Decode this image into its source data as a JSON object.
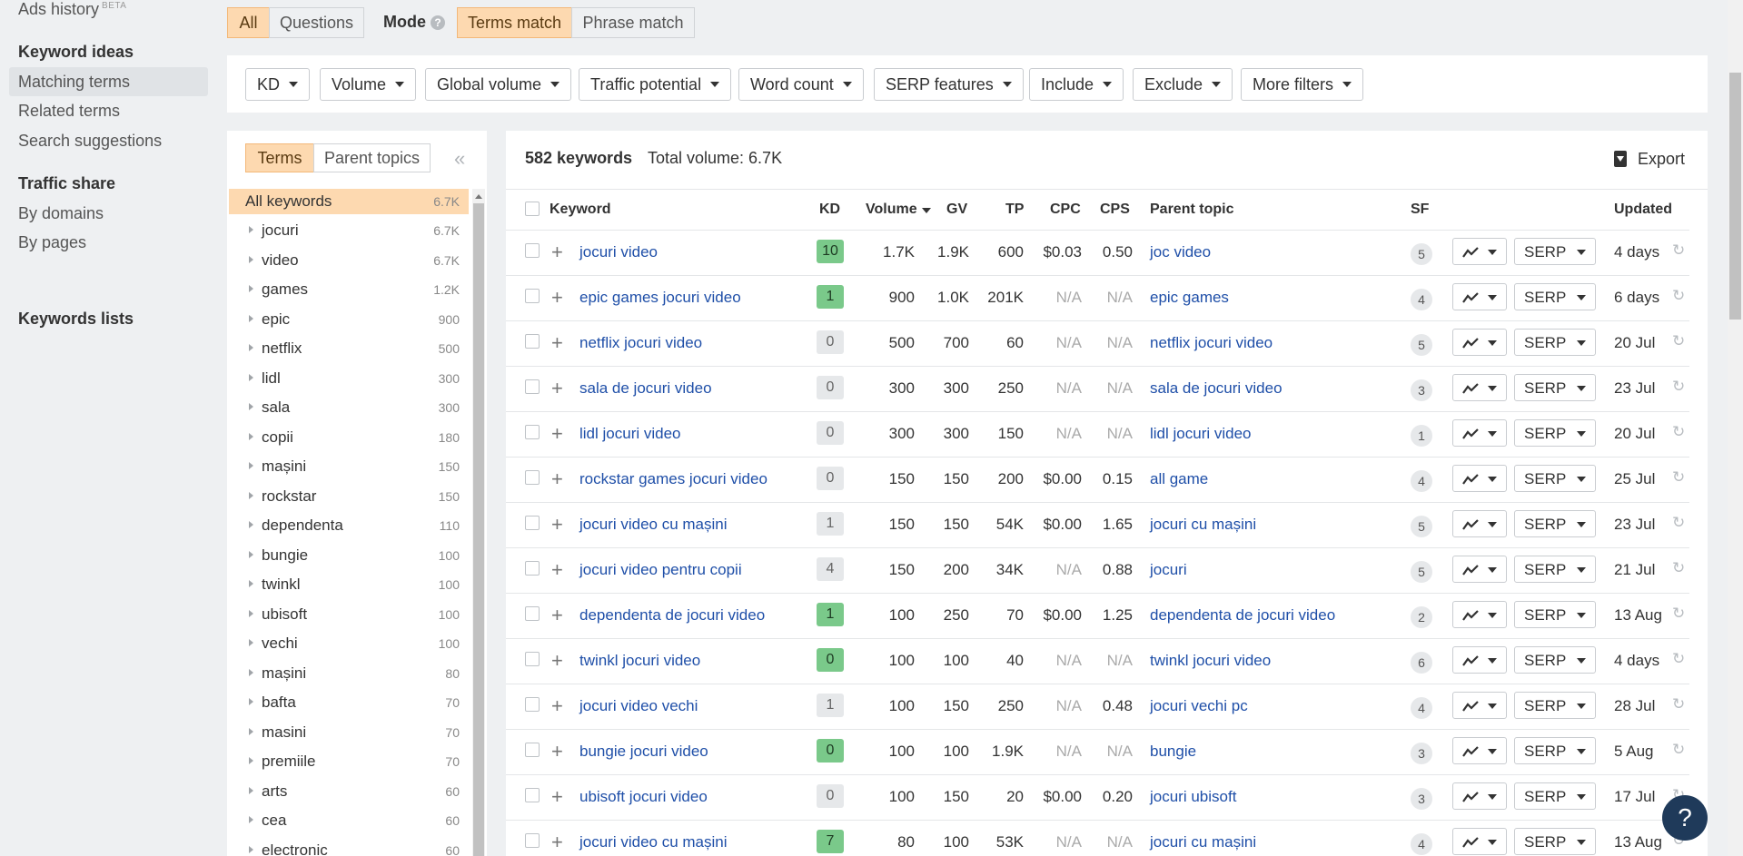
{
  "sidebar": {
    "ads_history": "Ads history",
    "beta": "BETA",
    "keyword_ideas_heading": "Keyword ideas",
    "keyword_ideas": [
      "Matching terms",
      "Related terms",
      "Search suggestions"
    ],
    "traffic_share_heading": "Traffic share",
    "traffic_share": [
      "By domains",
      "By pages"
    ],
    "keywords_lists_heading": "Keywords lists"
  },
  "mode_bar": {
    "all": "All",
    "questions": "Questions",
    "mode_label": "Mode",
    "help": "?",
    "terms_match": "Terms match",
    "phrase_match": "Phrase match"
  },
  "filters": [
    "KD",
    "Volume",
    "Global volume",
    "Traffic potential",
    "Word count",
    "SERP features",
    "Include",
    "Exclude",
    "More filters"
  ],
  "left_panel": {
    "tab_terms": "Terms",
    "tab_parent_topics": "Parent topics",
    "collapse": "«",
    "all_keywords": {
      "name": "All keywords",
      "count": "6.7K"
    },
    "items": [
      {
        "name": "jocuri",
        "count": "6.7K"
      },
      {
        "name": "video",
        "count": "6.7K"
      },
      {
        "name": "games",
        "count": "1.2K"
      },
      {
        "name": "epic",
        "count": "900"
      },
      {
        "name": "netflix",
        "count": "500"
      },
      {
        "name": "lidl",
        "count": "300"
      },
      {
        "name": "sala",
        "count": "300"
      },
      {
        "name": "copii",
        "count": "180"
      },
      {
        "name": "mașini",
        "count": "150"
      },
      {
        "name": "rockstar",
        "count": "150"
      },
      {
        "name": "dependenta",
        "count": "110"
      },
      {
        "name": "bungie",
        "count": "100"
      },
      {
        "name": "twinkl",
        "count": "100"
      },
      {
        "name": "ubisoft",
        "count": "100"
      },
      {
        "name": "vechi",
        "count": "100"
      },
      {
        "name": "mașini",
        "count": "80"
      },
      {
        "name": "bafta",
        "count": "70"
      },
      {
        "name": "masini",
        "count": "70"
      },
      {
        "name": "premiile",
        "count": "70"
      },
      {
        "name": "arts",
        "count": "60"
      },
      {
        "name": "cea",
        "count": "60"
      },
      {
        "name": "electronic",
        "count": "60"
      }
    ]
  },
  "table": {
    "keyword_count": "582 keywords",
    "total_volume": "Total volume: 6.7K",
    "export": "Export",
    "headers": {
      "keyword": "Keyword",
      "kd": "KD",
      "volume": "Volume",
      "gv": "GV",
      "tp": "TP",
      "cpc": "CPC",
      "cps": "CPS",
      "parent_topic": "Parent topic",
      "sf": "SF",
      "updated": "Updated"
    },
    "serp_label": "SERP",
    "rows": [
      {
        "keyword": "jocuri video",
        "kd": "10",
        "kd_level": "green",
        "volume": "1.7K",
        "gv": "1.9K",
        "tp": "600",
        "cpc": "$0.03",
        "cps": "0.50",
        "parent": "joc video",
        "sf": "5",
        "updated": "4 days"
      },
      {
        "keyword": "epic games jocuri video",
        "kd": "1",
        "kd_level": "green",
        "volume": "900",
        "gv": "1.0K",
        "tp": "201K",
        "cpc": "N/A",
        "cps": "N/A",
        "parent": "epic games",
        "sf": "4",
        "updated": "6 days"
      },
      {
        "keyword": "netflix jocuri video",
        "kd": "0",
        "kd_level": "grey",
        "volume": "500",
        "gv": "700",
        "tp": "60",
        "cpc": "N/A",
        "cps": "N/A",
        "parent": "netflix jocuri video",
        "sf": "5",
        "updated": "20 Jul"
      },
      {
        "keyword": "sala de jocuri video",
        "kd": "0",
        "kd_level": "grey",
        "volume": "300",
        "gv": "300",
        "tp": "250",
        "cpc": "N/A",
        "cps": "N/A",
        "parent": "sala de jocuri video",
        "sf": "3",
        "updated": "23 Jul"
      },
      {
        "keyword": "lidl jocuri video",
        "kd": "0",
        "kd_level": "grey",
        "volume": "300",
        "gv": "300",
        "tp": "150",
        "cpc": "N/A",
        "cps": "N/A",
        "parent": "lidl jocuri video",
        "sf": "1",
        "updated": "20 Jul"
      },
      {
        "keyword": "rockstar games jocuri video",
        "kd": "0",
        "kd_level": "grey",
        "volume": "150",
        "gv": "150",
        "tp": "200",
        "cpc": "$0.00",
        "cps": "0.15",
        "parent": "all game",
        "sf": "4",
        "updated": "25 Jul"
      },
      {
        "keyword": "jocuri video cu mașini",
        "kd": "1",
        "kd_level": "grey",
        "volume": "150",
        "gv": "150",
        "tp": "54K",
        "cpc": "$0.00",
        "cps": "1.65",
        "parent": "jocuri cu mașini",
        "sf": "5",
        "updated": "23 Jul"
      },
      {
        "keyword": "jocuri video pentru copii",
        "kd": "4",
        "kd_level": "grey",
        "volume": "150",
        "gv": "200",
        "tp": "34K",
        "cpc": "N/A",
        "cps": "0.88",
        "parent": "jocuri",
        "sf": "5",
        "updated": "21 Jul"
      },
      {
        "keyword": "dependenta de jocuri video",
        "kd": "1",
        "kd_level": "green",
        "volume": "100",
        "gv": "250",
        "tp": "70",
        "cpc": "$0.00",
        "cps": "1.25",
        "parent": "dependenta de jocuri video",
        "sf": "2",
        "updated": "13 Aug"
      },
      {
        "keyword": "twinkl jocuri video",
        "kd": "0",
        "kd_level": "green",
        "volume": "100",
        "gv": "100",
        "tp": "40",
        "cpc": "N/A",
        "cps": "N/A",
        "parent": "twinkl jocuri video",
        "sf": "6",
        "updated": "4 days"
      },
      {
        "keyword": "jocuri video vechi",
        "kd": "1",
        "kd_level": "grey",
        "volume": "100",
        "gv": "150",
        "tp": "250",
        "cpc": "N/A",
        "cps": "0.48",
        "parent": "jocuri vechi pc",
        "sf": "4",
        "updated": "28 Jul"
      },
      {
        "keyword": "bungie jocuri video",
        "kd": "0",
        "kd_level": "green",
        "volume": "100",
        "gv": "100",
        "tp": "1.9K",
        "cpc": "N/A",
        "cps": "N/A",
        "parent": "bungie",
        "sf": "3",
        "updated": "5 Aug"
      },
      {
        "keyword": "ubisoft jocuri video",
        "kd": "0",
        "kd_level": "grey",
        "volume": "100",
        "gv": "150",
        "tp": "20",
        "cpc": "$0.00",
        "cps": "0.20",
        "parent": "jocuri ubisoft",
        "sf": "3",
        "updated": "17 Jul"
      },
      {
        "keyword": "jocuri video cu mașini",
        "kd": "7",
        "kd_level": "green",
        "volume": "80",
        "gv": "100",
        "tp": "53K",
        "cpc": "N/A",
        "cps": "N/A",
        "parent": "jocuri cu mașini",
        "sf": "4",
        "updated": "13 Aug"
      }
    ]
  },
  "help_fab": "?",
  "colors": {
    "accent": "#fdd9b0",
    "link": "#1f4fa8",
    "kd_green": "#7ac98a"
  }
}
